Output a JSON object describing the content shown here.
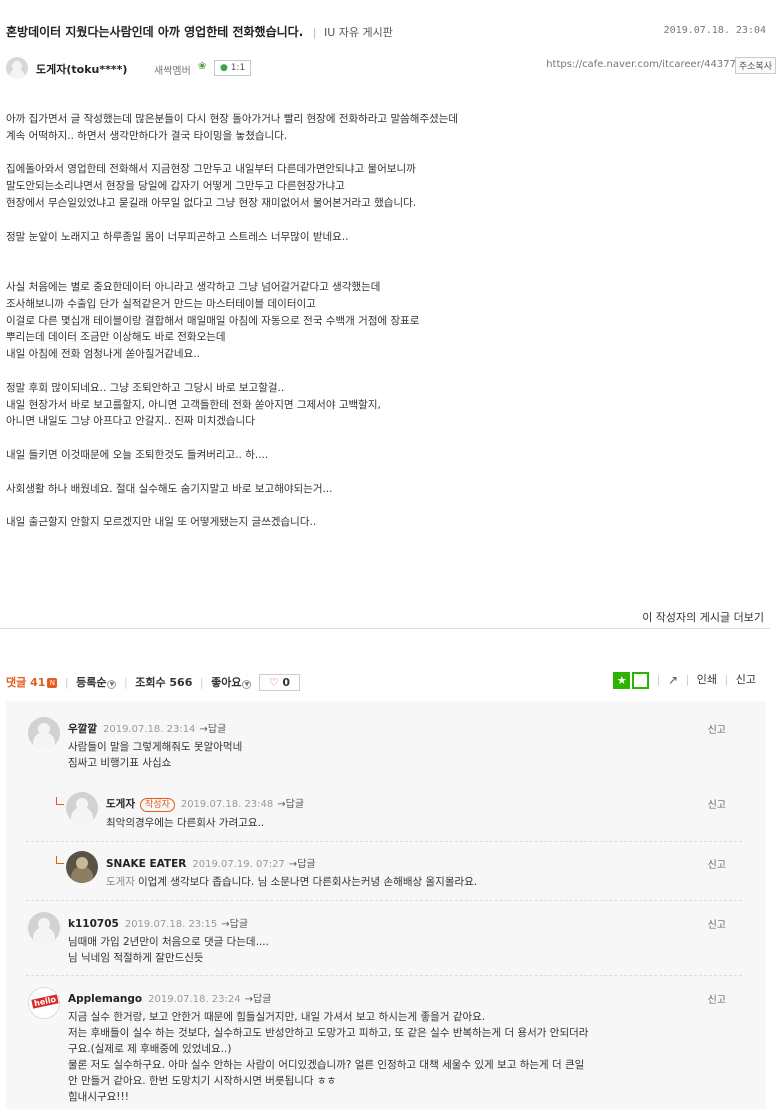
{
  "post": {
    "title": "혼방데이터 지웠다는사람인데 아까 영업한테 전화했습니다.",
    "board": "IU 자유 게시판",
    "date": "2019.07.18. 23:04",
    "author": "도게자(toku****)",
    "level": "새싹멤버",
    "chat_label": "1:1",
    "url": "https://cafe.naver.com/itcareer/44377",
    "copy_label": "주소복사",
    "body": [
      "아까 집가면서 글 작성했는데 많은분들이 다시 현장 돌아가거나 빨리 현장에 전화하라고 말씀해주셨는데",
      "계속 어떡하지.. 하면서 생각만하다가 결국 타이밍을 놓쳤습니다.",
      "",
      "집에돌아와서 영업한테 전화해서 지금현장 그만두고 내일부터 다른데가면안되냐고 물어보니까",
      "말도안되는소리냐면서 현장을 당일에 갑자기 어떻게 그만두고 다른현장가냐고",
      "현장에서 무슨일있었냐고 묻길래 아무일 없다고 그냥 현장 재미없어서 물어본거라고 했습니다.",
      "",
      "정말 눈앞이 노래지고 하루종일 몸이 너무피곤하고 스트레스 너무많이 받네요..",
      "",
      "",
      "사실 처음에는 별로 중요한데이터 아니라고 생각하고 그냥 넘어갈거같다고 생각했는데",
      "조사해보니까 수출입 단가 실적같은거 만드는 마스터테이블 데이터이고",
      "이걸로 다른 몇십개 테이블이랑 결합해서 매일매일 아침에 자동으로 전국 수백개 거점에 장표로",
      "뿌리는데 데이터 조금만 이상해도 바로 전화오는데",
      "내일 아침에 전화 엄청나게 쏟아질거같네요..",
      "",
      "정말 후회 많이되네요.. 그냥 조퇴안하고 그당시 바로 보고할걸..",
      "내일 현장가서 바로 보고를할지, 아니면 고객들한테 전화 쏟아지면 그제서야 고백할지,",
      "아니면 내일도 그냥 아프다고 안갈지.. 진짜 미치겠습니다",
      "",
      "내일 들키면 이것때문에 오늘 조퇴한것도 들켜버리고.. 하....",
      "",
      "사회생활 하나 배웠네요. 절대 실수해도 숨기지말고 바로 보고해야되는거...",
      "",
      "내일 출근할지 안할지 모르겠지만 내일 또 어떻게됐는지 글쓰겠습니다.."
    ],
    "more_label": "이 작성자의 게시글 더보기"
  },
  "stats": {
    "comment_label": "댓글 41",
    "sort_label": "등록순",
    "views_label": "조회수 566",
    "like_label": "좋아요",
    "like_count": "0",
    "print_label": "인쇄",
    "report_label": "신고"
  },
  "comments": [
    {
      "nick": "우깔깔",
      "date": "2019.07.18. 23:14",
      "reply": "답글",
      "report": "신고",
      "lines": [
        "사람들이 말을 그렇게해줘도 못알아먹네",
        "짐싸고 비행기표 사십쇼"
      ]
    },
    {
      "nick": "도게자",
      "writer_badge": "작성자",
      "date": "2019.07.18. 23:48",
      "reply": "답글",
      "report": "신고",
      "lines": [
        "최악의경우에는 다른회사 가려고요.."
      ]
    },
    {
      "nick": "SNAKE EATER",
      "date": "2019.07.19. 07:27",
      "reply": "답글",
      "report": "신고",
      "mention": "도게자",
      "lines": [
        "이업계 생각보다 좁습니다. 님 소문나면 다른회사는커녕 손해배상 올지몰라요."
      ]
    },
    {
      "nick": "k110705",
      "date": "2019.07.18. 23:15",
      "reply": "답글",
      "report": "신고",
      "lines": [
        "님때매 가입 2년만이 처음으로 댓글 다는데....",
        "님 닉네임 적절하게 잘만드신듯"
      ]
    },
    {
      "nick": "Applemango",
      "date": "2019.07.18. 23:24",
      "reply": "답글",
      "report": "신고",
      "avatar_text": "hello",
      "lines": [
        "지금 실수 한거랑, 보고 안한거 때문에 힘들실거지만, 내일 가셔서 보고 하시는게 좋을거 같아요.",
        "저는 후배들이 실수 하는 것보다, 실수하고도 반성안하고 도망가고 피하고, 또 같은 실수 반복하는게 더 용서가 안되더라",
        "구요.(실제로 제 후배중에 있었네요..)",
        "물론 저도 실수하구요. 아마 실수 안하는 사람이 어디있겠습니까? 얼른 인정하고 대책 세울수 있게 보고 하는게 더 큰일",
        "안 만들거 같아요. 한번 도망치기 시작하시면 버릇됩니다 ㅎㅎ",
        "힘내시구요!!!"
      ]
    }
  ]
}
